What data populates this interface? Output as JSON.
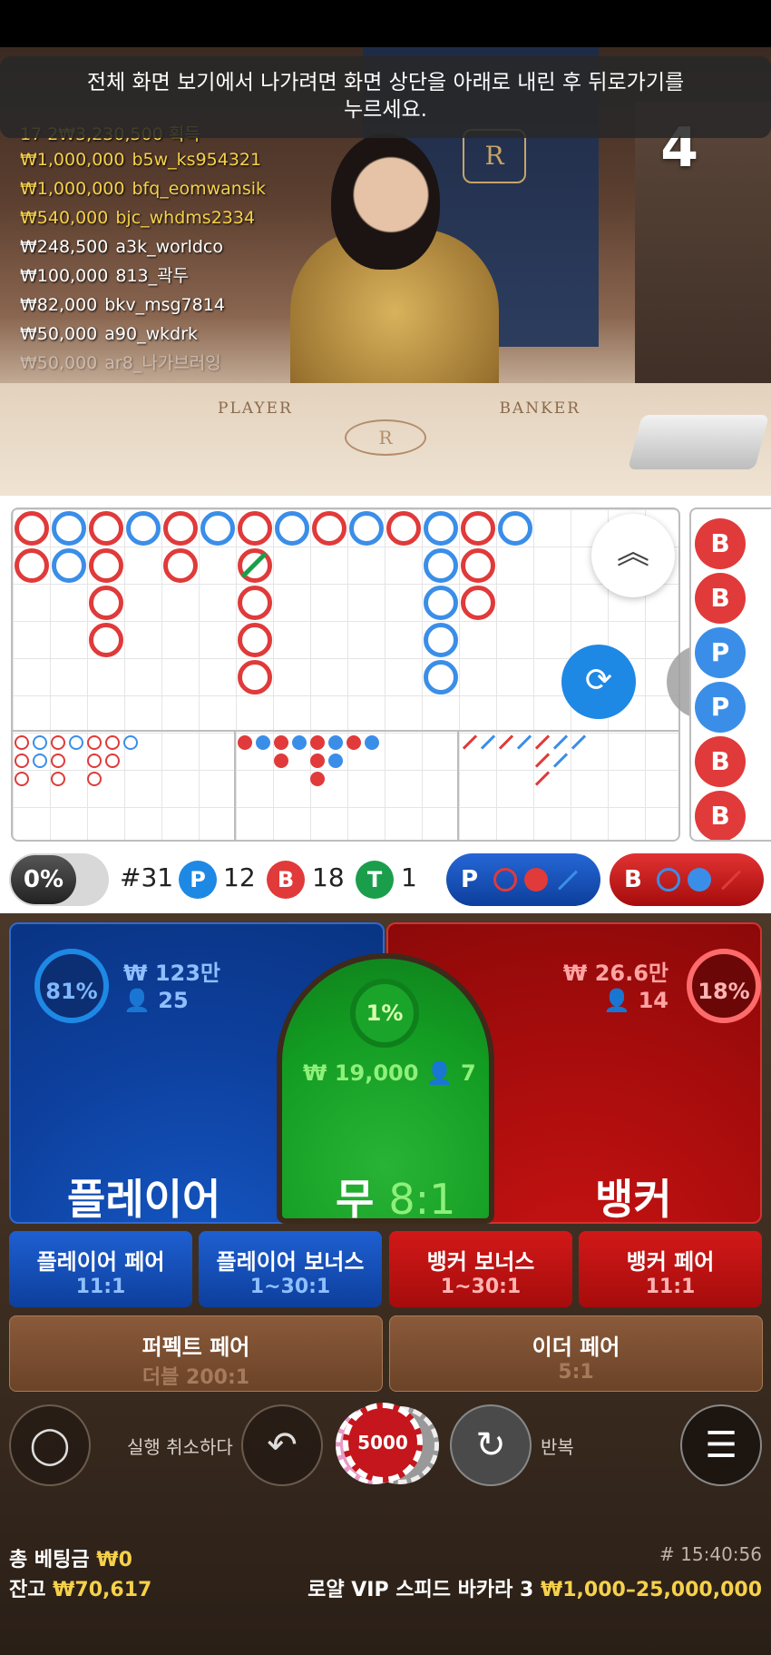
{
  "toast": {
    "line1": "전체 화면 보기에서 나가려면 화면 상단을 아래로 내린 후 뒤로가기를",
    "line2": "누르세요."
  },
  "countdown": "4",
  "winners": {
    "total": "17 2₩3,230,500 획득",
    "list": [
      {
        "amount": "₩1,000,000",
        "user": "b5w_ks954321"
      },
      {
        "amount": "₩1,000,000",
        "user": "bfq_eomwansik"
      },
      {
        "amount": "₩540,000",
        "user": "bjc_whdms2334"
      },
      {
        "amount": "₩248,500",
        "user": "a3k_worldco"
      },
      {
        "amount": "₩100,000",
        "user": "813_곽두"
      },
      {
        "amount": "₩82,000",
        "user": "bkv_msg7814"
      },
      {
        "amount": "₩50,000",
        "user": "a90_wkdrk"
      },
      {
        "amount": "₩50,000",
        "user": "ar8_나가브러잉"
      }
    ]
  },
  "table": {
    "player_word": "PLAYER",
    "banker_word": "BANKER",
    "logo": "R"
  },
  "roadmap": {
    "bead_letters": [
      "B",
      "B",
      "P",
      "P",
      "B",
      "B"
    ]
  },
  "stats": {
    "percent": "0%",
    "round": "#31",
    "p_label": "P",
    "p_count": "12",
    "b_label": "B",
    "b_count": "18",
    "t_label": "T",
    "t_count": "1",
    "predict_p": "P",
    "predict_b": "B"
  },
  "player": {
    "label": "플레이어",
    "pct": "81%",
    "amount": "₩ 123만",
    "users": "25"
  },
  "tie": {
    "label": "무",
    "payout": "8:1",
    "pct": "1%",
    "amount": "₩ 19,000",
    "users": "7"
  },
  "banker": {
    "label": "뱅커",
    "pct": "18%",
    "amount": "₩ 26.6만",
    "users": "14"
  },
  "side_bets": [
    {
      "name": "플레이어 페어",
      "payout": "11:1"
    },
    {
      "name": "플레이어 보너스",
      "payout": "1~30:1"
    },
    {
      "name": "뱅커 보너스",
      "payout": "1~30:1"
    },
    {
      "name": "뱅커 페어",
      "payout": "11:1"
    }
  ],
  "wide_bets": [
    {
      "name": "퍼펙트 페어",
      "payout": "더블 200:1"
    },
    {
      "name": "이더 페어",
      "payout": "5:1"
    }
  ],
  "controls": {
    "undo_label": "실행 취소하다",
    "chip_value": "5000",
    "repeat_label": "반복"
  },
  "footer": {
    "total_bet_label": "총 베팅금",
    "total_bet_value": "₩0",
    "balance_label": "잔고",
    "balance_value": "₩70,617",
    "round_time": "# 15:40:56",
    "table_name": "로얄 VIP 스피드 바카라 3",
    "limits": "₩1,000–25,000,000"
  },
  "colors": {
    "player": "#0d3f9c",
    "banker": "#a60c0c",
    "tie": "#139c22",
    "gold": "#f6d14a"
  }
}
